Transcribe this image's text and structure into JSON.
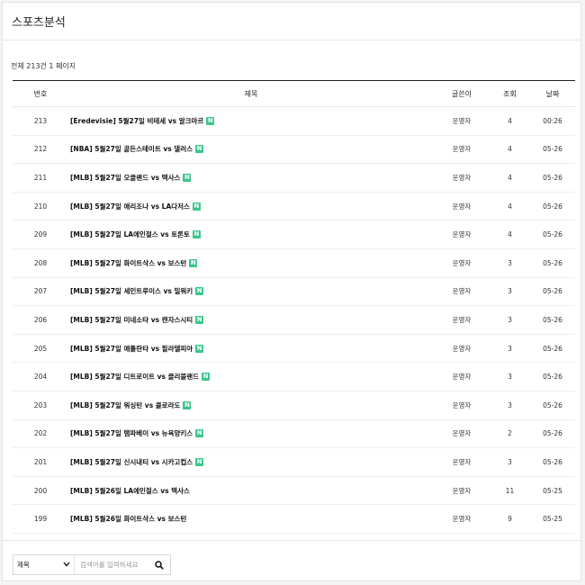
{
  "page": {
    "title": "스포츠분석"
  },
  "summary": {
    "text": "전체 213건 1 페이지"
  },
  "table": {
    "headers": {
      "num": "번호",
      "title": "제목",
      "author": "글쓴이",
      "views": "조회",
      "date": "날짜"
    },
    "rows": [
      {
        "num": "213",
        "title": "[Eredevisie] 5월27일 비테세 vs 알크마르",
        "new": "N",
        "author": "운영자",
        "views": "4",
        "date": "00:26"
      },
      {
        "num": "212",
        "title": "[NBA] 5월27일 골든스테이트 vs 댈러스",
        "new": "N",
        "author": "운영자",
        "views": "4",
        "date": "05-26"
      },
      {
        "num": "211",
        "title": "[MLB] 5월27일 오클랜드 vs 텍사스",
        "new": "N",
        "author": "운영자",
        "views": "4",
        "date": "05-26"
      },
      {
        "num": "210",
        "title": "[MLB] 5월27일 애리조나 vs LA다저스",
        "new": "N",
        "author": "운영자",
        "views": "4",
        "date": "05-26"
      },
      {
        "num": "209",
        "title": "[MLB] 5월27일 LA에인절스 vs 토론토",
        "new": "N",
        "author": "운영자",
        "views": "4",
        "date": "05-26"
      },
      {
        "num": "208",
        "title": "[MLB] 5월27일 화이트삭스 vs 보스턴",
        "new": "N",
        "author": "운영자",
        "views": "3",
        "date": "05-26"
      },
      {
        "num": "207",
        "title": "[MLB] 5월27일 세인트루이스 vs 밀워키",
        "new": "N",
        "author": "운영자",
        "views": "3",
        "date": "05-26"
      },
      {
        "num": "206",
        "title": "[MLB] 5월27일 미네소타 vs 캔자스시티",
        "new": "N",
        "author": "운영자",
        "views": "3",
        "date": "05-26"
      },
      {
        "num": "205",
        "title": "[MLB] 5월27일 애틀란타 vs 필라델피아",
        "new": "N",
        "author": "운영자",
        "views": "3",
        "date": "05-26"
      },
      {
        "num": "204",
        "title": "[MLB] 5월27일 디트로이트 vs 클리블랜드",
        "new": "N",
        "author": "운영자",
        "views": "3",
        "date": "05-26"
      },
      {
        "num": "203",
        "title": "[MLB] 5월27일 워싱턴 vs 콜로라도",
        "new": "N",
        "author": "운영자",
        "views": "3",
        "date": "05-26"
      },
      {
        "num": "202",
        "title": "[MLB] 5월27일 탬파베이 vs 뉴욕양키스",
        "new": "N",
        "author": "운영자",
        "views": "2",
        "date": "05-26"
      },
      {
        "num": "201",
        "title": "[MLB] 5월27일 신시내티 vs 시카고컵스",
        "new": "N",
        "author": "운영자",
        "views": "3",
        "date": "05-26"
      },
      {
        "num": "200",
        "title": "[MLB] 5월26일 LA에인절스 vs 텍사스",
        "new": "",
        "author": "운영자",
        "views": "11",
        "date": "05-25"
      },
      {
        "num": "199",
        "title": "[MLB] 5월26일 화이트삭스 vs 보스턴",
        "new": "",
        "author": "운영자",
        "views": "9",
        "date": "05-25"
      }
    ]
  },
  "search": {
    "field_selected": "제목",
    "placeholder": "검색어를 입력하세요",
    "icon": "search-icon",
    "chevron_icon": "chevron-down-icon"
  },
  "colors": {
    "new_badge": "#3ac68a"
  }
}
